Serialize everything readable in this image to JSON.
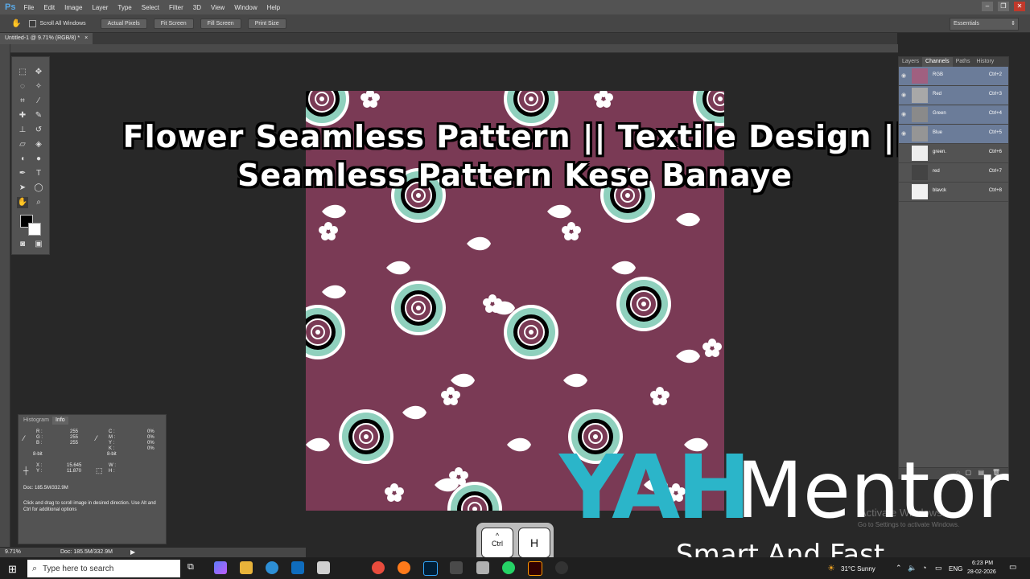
{
  "app": {
    "logo": "Ps"
  },
  "menu": [
    "File",
    "Edit",
    "Image",
    "Layer",
    "Type",
    "Select",
    "Filter",
    "3D",
    "View",
    "Window",
    "Help"
  ],
  "options_bar": {
    "scroll_all_windows": "Scroll All Windows",
    "buttons": [
      "Actual Pixels",
      "Fit Screen",
      "Fill Screen",
      "Print Size"
    ],
    "workspace": "Essentials"
  },
  "document_tab": "Untitled-1 @ 9.71% (RGB/8) *",
  "title_overlay": {
    "line1": "Flower Seamless Pattern || Textile Design ||",
    "line2": "Seamless Pattern Kese Banaye"
  },
  "channels_panel": {
    "tabs": [
      "Layers",
      "Channels",
      "Paths",
      "History"
    ],
    "active_tab": "Channels",
    "channels": [
      {
        "name": "RGB",
        "shortcut": "Ctrl+2",
        "selected": true
      },
      {
        "name": "Red",
        "shortcut": "Ctrl+3",
        "selected": true
      },
      {
        "name": "Green",
        "shortcut": "Ctrl+4",
        "selected": true
      },
      {
        "name": "Blue",
        "shortcut": "Ctrl+5",
        "selected": true
      },
      {
        "name": "green.",
        "shortcut": "Ctrl+6",
        "selected": false
      },
      {
        "name": "red",
        "shortcut": "Ctrl+7",
        "selected": false
      },
      {
        "name": "blavck",
        "shortcut": "Ctrl+8",
        "selected": false
      }
    ]
  },
  "info_panel": {
    "tabs": [
      "Histogram",
      "Info"
    ],
    "rgb": {
      "R": "255",
      "G": "255",
      "B": "255"
    },
    "cmyk": {
      "C": "0%",
      "M": "0%",
      "Y": "0%",
      "K": "0%"
    },
    "bit_left": "8-bit",
    "bit_right": "8-bit",
    "xy": {
      "X": "15.645",
      "Y": "11.870"
    },
    "wh": {
      "W": "",
      "H": ""
    },
    "doc": "Doc: 185.5M/332.9M",
    "hint": "Click and drag to scroll image in desired direction.  Use Alt and Ctrl for additional options"
  },
  "status_bar": {
    "zoom": "9.71%",
    "doc": "Doc: 185.5M/332.9M"
  },
  "watermark": {
    "line1": "Activate Windows",
    "line2": "Go to Settings to activate Windows."
  },
  "brand": {
    "part1": "YAH",
    "part2": "Mentor",
    "tagline": "Smart And Fast"
  },
  "keys": {
    "ctrl": "Ctrl",
    "ctrl_symbol": "^",
    "h": "H"
  },
  "taskbar": {
    "search_placeholder": "Type here to search",
    "weather": "31°C  Sunny",
    "lang": "ENG",
    "time": "6:23 PM",
    "date": "28-02-2026"
  },
  "colors": {
    "canvas": "#7a3a55",
    "teal": "#2bb5c9",
    "selected_row": "#6b7c99"
  }
}
